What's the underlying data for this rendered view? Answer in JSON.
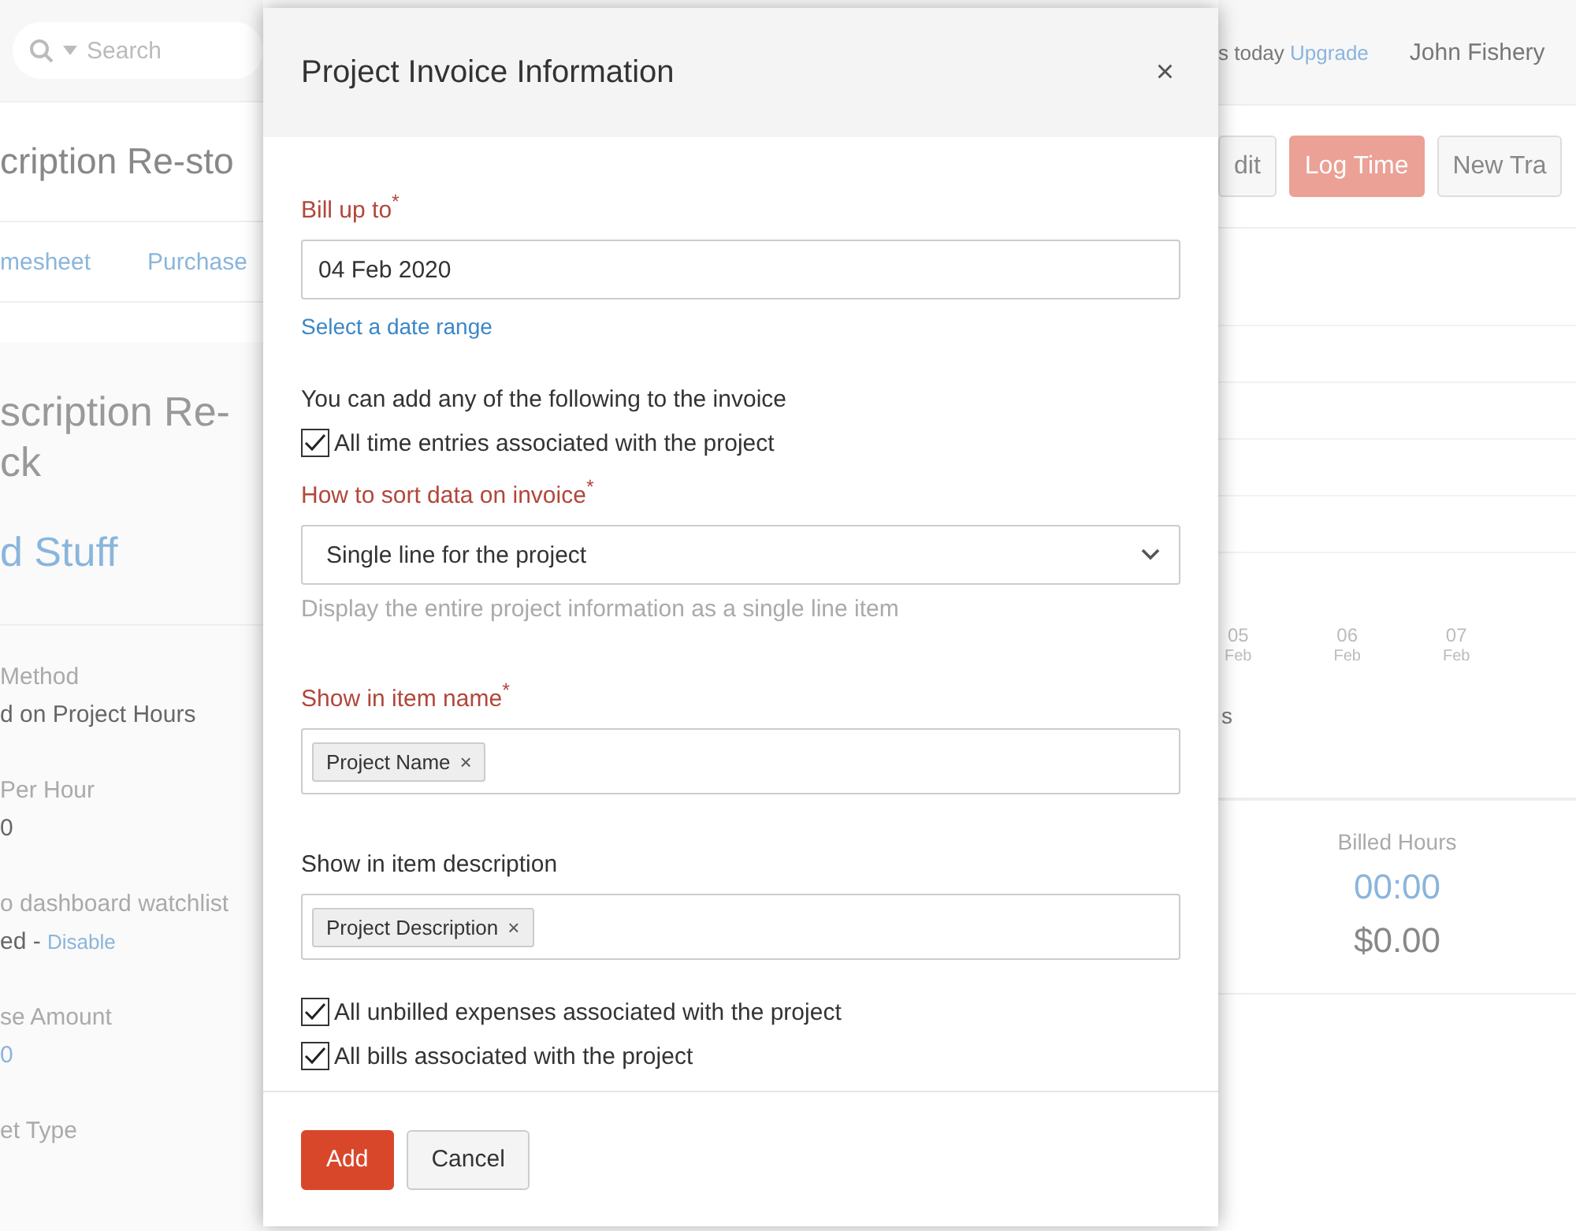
{
  "background_left": {
    "search": {
      "placeholder": "Search"
    },
    "title": "cription Re-sto",
    "tabs": [
      {
        "label": "mesheet",
        "selected": false
      },
      {
        "label": "Purchase",
        "selected": false
      }
    ],
    "project_title": [
      "scription Re-",
      "ck"
    ],
    "customer": "d Stuff",
    "fields": [
      {
        "label": "Method",
        "value": "d on Project Hours"
      },
      {
        "label": "Per Hour",
        "value": "0"
      },
      {
        "label": "o dashboard watchlist",
        "value": "ed - ",
        "link": "Disable"
      },
      {
        "label": "se Amount",
        "link": "0"
      },
      {
        "label": "et Type"
      }
    ]
  },
  "background_right": {
    "trial_text": "s today",
    "upgrade": "Upgrade",
    "user": "John Fishery",
    "buttons": [
      {
        "label": "dit",
        "kind": "plain"
      },
      {
        "label": "Log Time",
        "kind": "primary"
      },
      {
        "label": "New Tra",
        "kind": "plain"
      }
    ],
    "axis_labels": [
      {
        "day": "05",
        "month": "Feb"
      },
      {
        "day": "06",
        "month": "Feb"
      },
      {
        "day": "07",
        "month": "Feb"
      }
    ],
    "legend_fragment": "s",
    "billed": {
      "label": "Billed Hours",
      "hours": "00:00",
      "amount": "$0.00"
    }
  },
  "modal": {
    "title": "Project Invoice Information",
    "close": "×",
    "bill_up_to": {
      "label": "Bill up to$^{*}$",
      "required": true,
      "value": "04 Feb 2020"
    },
    "date_range_link": "Select a date range",
    "intro": "You can add any of the following to the invoice",
    "time_entries": {
      "label": "All time entries associated with the project",
      "checked": true
    },
    "sort": {
      "label": "How to sort data on invoice$^{*}$",
      "required": true,
      "value": "Single line for the project",
      "hint": "Display the entire project information as a single line item"
    },
    "item_name": {
      "label": "Show in item name$^{*}$",
      "required": true,
      "tags": [
        {
          "label": "Project Name",
          "remove": "×"
        }
      ]
    },
    "item_description": {
      "label": "Show in item description",
      "required": false,
      "tags": [
        {
          "label": "Project Description",
          "remove": "×"
        }
      ]
    },
    "options": [
      {
        "label": "All unbilled expenses associated with the project",
        "checked": true
      },
      {
        "label": "All bills associated with the project",
        "checked": true
      }
    ],
    "buttons": [
      {
        "label": "Add",
        "kind": "primary"
      },
      {
        "label": "Cancel",
        "kind": "secondary"
      }
    ]
  }
}
